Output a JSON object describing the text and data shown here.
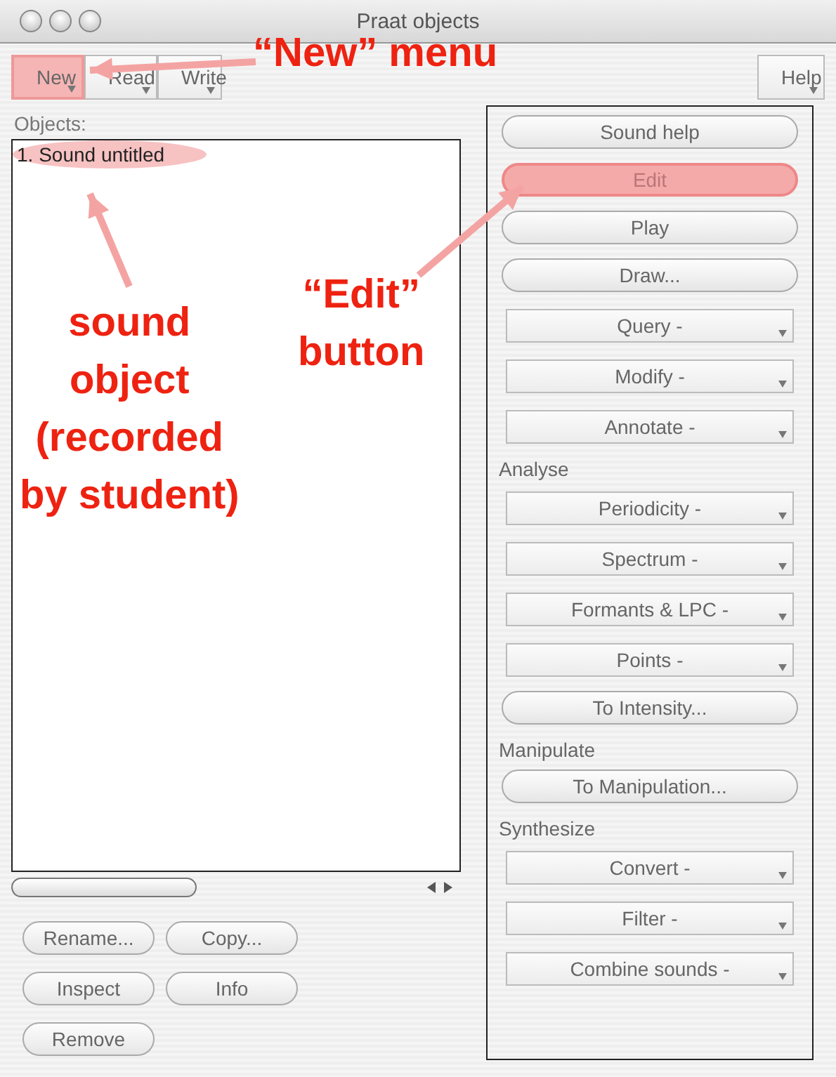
{
  "window": {
    "title": "Praat objects"
  },
  "menus": [
    {
      "label": "New",
      "highlighted": true
    },
    {
      "label": "Read",
      "highlighted": false
    },
    {
      "label": "Write",
      "highlighted": false
    }
  ],
  "help_menu": {
    "label": "Help"
  },
  "objects": {
    "label": "Objects:",
    "items": [
      {
        "label": "1. Sound untitled",
        "highlighted": true
      }
    ]
  },
  "object_buttons": [
    {
      "label": "Rename..."
    },
    {
      "label": "Copy..."
    },
    {
      "label": "Inspect"
    },
    {
      "label": "Info"
    },
    {
      "label": "Remove"
    }
  ],
  "actions": [
    {
      "kind": "button",
      "label": "Sound help",
      "highlighted": false
    },
    {
      "kind": "button",
      "label": "Edit",
      "highlighted": true
    },
    {
      "kind": "button",
      "label": "Play",
      "highlighted": false
    },
    {
      "kind": "button",
      "label": "Draw...",
      "highlighted": false
    },
    {
      "kind": "menu",
      "label": "Query -",
      "highlighted": false
    },
    {
      "kind": "menu",
      "label": "Modify -",
      "highlighted": false
    },
    {
      "kind": "menu",
      "label": "Annotate -",
      "highlighted": false
    },
    {
      "kind": "heading",
      "label": "Analyse"
    },
    {
      "kind": "menu",
      "label": "Periodicity -",
      "highlighted": false
    },
    {
      "kind": "menu",
      "label": "Spectrum -",
      "highlighted": false
    },
    {
      "kind": "menu",
      "label": "Formants & LPC -",
      "highlighted": false
    },
    {
      "kind": "menu",
      "label": "Points -",
      "highlighted": false
    },
    {
      "kind": "button",
      "label": "To Intensity...",
      "highlighted": false
    },
    {
      "kind": "heading",
      "label": "Manipulate"
    },
    {
      "kind": "button",
      "label": "To Manipulation...",
      "highlighted": false
    },
    {
      "kind": "heading",
      "label": "Synthesize"
    },
    {
      "kind": "menu",
      "label": "Convert -",
      "highlighted": false
    },
    {
      "kind": "menu",
      "label": "Filter -",
      "highlighted": false
    },
    {
      "kind": "menu",
      "label": "Combine sounds -",
      "highlighted": false
    }
  ],
  "annotations": [
    {
      "kind": "menu",
      "lines": [
        "“New” menu"
      ]
    },
    {
      "kind": "button",
      "lines": [
        "“Edit”",
        "button"
      ]
    },
    {
      "kind": "object",
      "lines": [
        "sound",
        "object",
        "(recorded",
        "by student)"
      ]
    }
  ]
}
